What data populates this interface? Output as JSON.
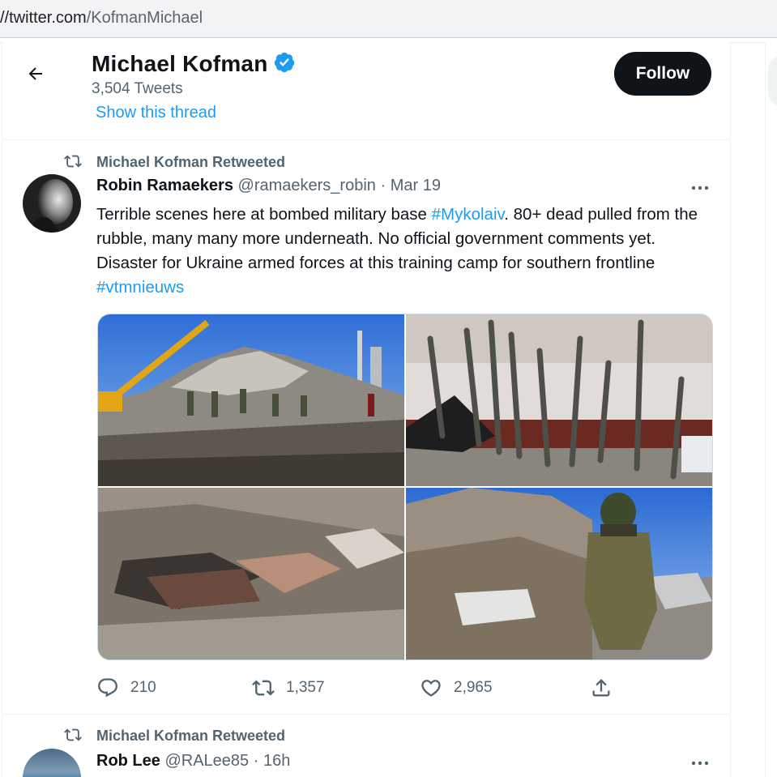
{
  "browser": {
    "url_prefix": "//",
    "url_host": "twitter.com",
    "url_path": "/KofmanMichael"
  },
  "header": {
    "name": "Michael Kofman",
    "tweet_count": "3,504 Tweets",
    "follow_label": "Follow",
    "show_thread": "Show this thread"
  },
  "tweet1": {
    "retweet_label": "Michael Kofman Retweeted",
    "author_name": "Robin Ramaekers",
    "handle": "@ramaekers_robin",
    "separator": "·",
    "time": "Mar 19",
    "text": {
      "part1": "Terrible scenes here at bombed military base ",
      "tag1": "#Mykolaiv",
      "part2": ". 80+ dead pulled from the rubble, many many more underneath. No official government comments yet. Disaster for Ukraine armed forces at this training camp for southern frontline ",
      "tag2": "#vtmnieuws"
    },
    "reply_count": "210",
    "retweet_count": "1,357",
    "like_count": "2,965"
  },
  "tweet2": {
    "retweet_label": "Michael Kofman Retweeted",
    "author_name": "Rob Lee",
    "handle": "@RALee85",
    "separator": "·",
    "time": "16h"
  },
  "colors": {
    "accent": "#1d9bf0",
    "text_primary": "#0f1419",
    "text_secondary": "#536471",
    "follow_bg": "#0f1419"
  },
  "icons": {
    "back": "arrow-left-icon",
    "verified": "verified-badge-icon",
    "retweet": "retweet-icon",
    "more": "more-dots-icon",
    "reply": "reply-icon",
    "like": "heart-icon",
    "share": "share-icon"
  }
}
